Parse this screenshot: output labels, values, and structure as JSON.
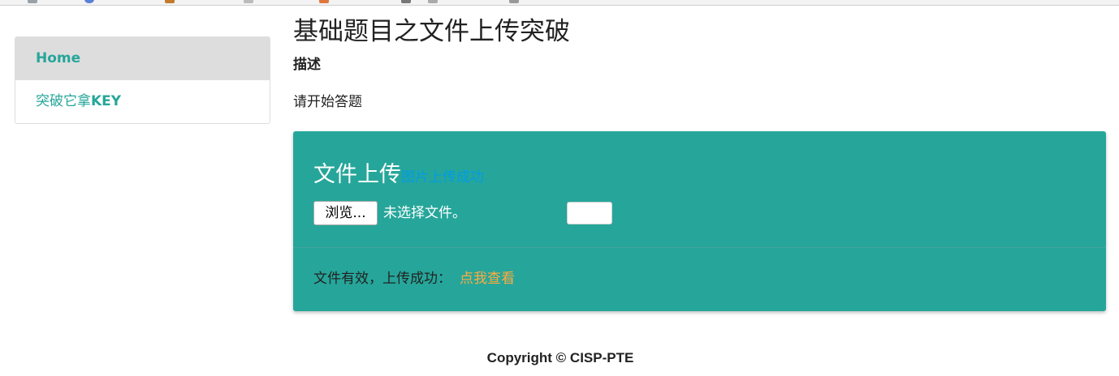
{
  "sidebar": {
    "items": [
      {
        "label": "Home"
      },
      {
        "label_prefix": "突破它拿",
        "label_key": "KEY"
      }
    ]
  },
  "main": {
    "title": "基础题目之文件上传突破",
    "description_heading": "描述",
    "description_text": "请开始答题"
  },
  "upload_card": {
    "title": "文件上传",
    "status_link": "图片上传成功",
    "browse_label": "浏览...",
    "no_file_text": "未选择文件。",
    "submit_label": "",
    "result_text": "文件有效，上传成功：",
    "view_link": "点我查看"
  },
  "footer": {
    "copyright": "Copyright © CISP-PTE"
  },
  "colors": {
    "accent": "#26a69a",
    "link_blue": "#039be5",
    "link_orange": "#ffab40"
  }
}
